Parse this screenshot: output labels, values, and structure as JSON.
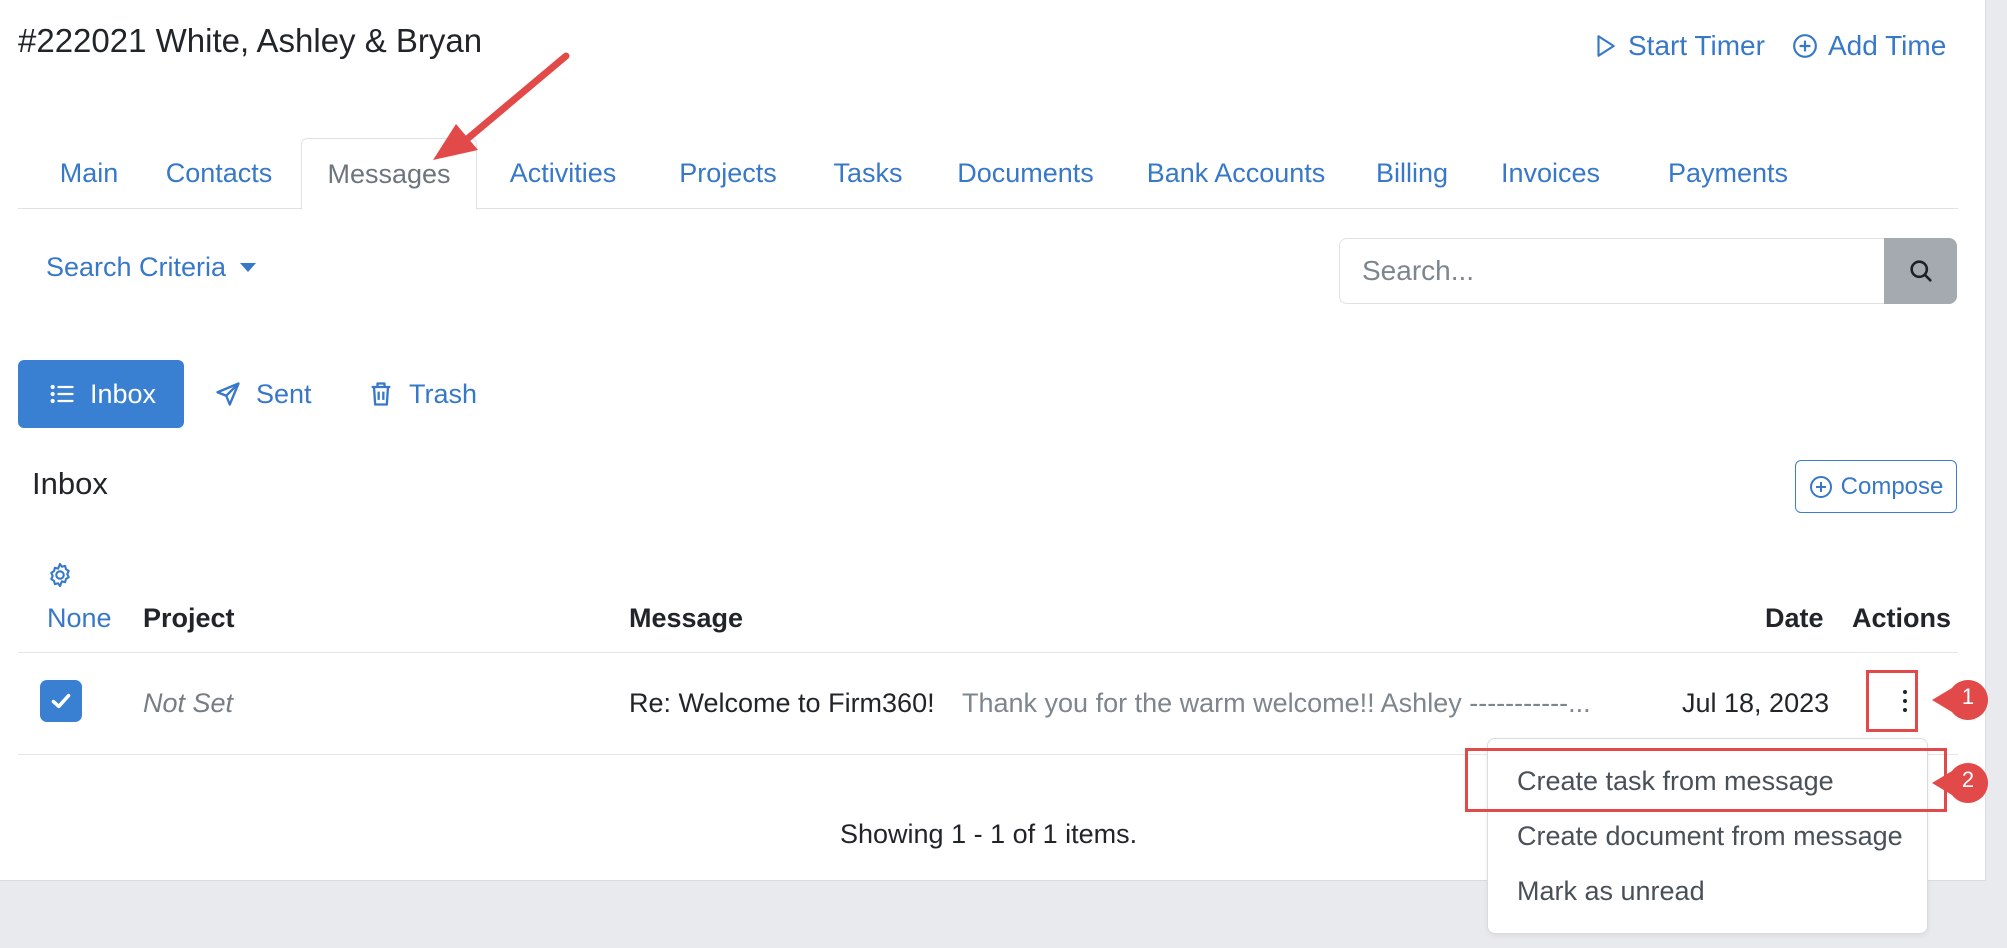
{
  "header": {
    "title": "#222021 White, Ashley & Bryan",
    "start_timer": "Start Timer",
    "add_time": "Add Time"
  },
  "tabs": [
    {
      "label": "Main"
    },
    {
      "label": "Contacts"
    },
    {
      "label": "Messages"
    },
    {
      "label": "Activities"
    },
    {
      "label": "Projects"
    },
    {
      "label": "Tasks"
    },
    {
      "label": "Documents"
    },
    {
      "label": "Bank Accounts"
    },
    {
      "label": "Billing"
    },
    {
      "label": "Invoices"
    },
    {
      "label": "Payments"
    }
  ],
  "active_tab": "Messages",
  "search": {
    "criteria_label": "Search Criteria",
    "placeholder": "Search...",
    "value": ""
  },
  "folders": {
    "inbox": "Inbox",
    "sent": "Sent",
    "trash": "Trash"
  },
  "section": {
    "title": "Inbox",
    "compose": "Compose"
  },
  "table": {
    "headers": {
      "select": "None",
      "project": "Project",
      "message": "Message",
      "date": "Date",
      "actions": "Actions"
    },
    "rows": [
      {
        "project": "Not Set",
        "subject": "Re: Welcome to Firm360!",
        "preview": "Thank you for the warm welcome!! Ashley -----------...",
        "date": "Jul 18, 2023",
        "checked": true
      }
    ],
    "footer": "Showing 1 - 1 of 1 items."
  },
  "row_menu": {
    "items": [
      {
        "label": "Create task from message"
      },
      {
        "label": "Create document from message"
      },
      {
        "label": "Mark as unread"
      }
    ]
  },
  "annotations": {
    "callout_1": "1",
    "callout_2": "2",
    "highlight_color": "#e24a4a"
  },
  "colors": {
    "accent": "#3878c8",
    "primary_button": "#3a80d2",
    "search_button": "#a5a9b0"
  }
}
